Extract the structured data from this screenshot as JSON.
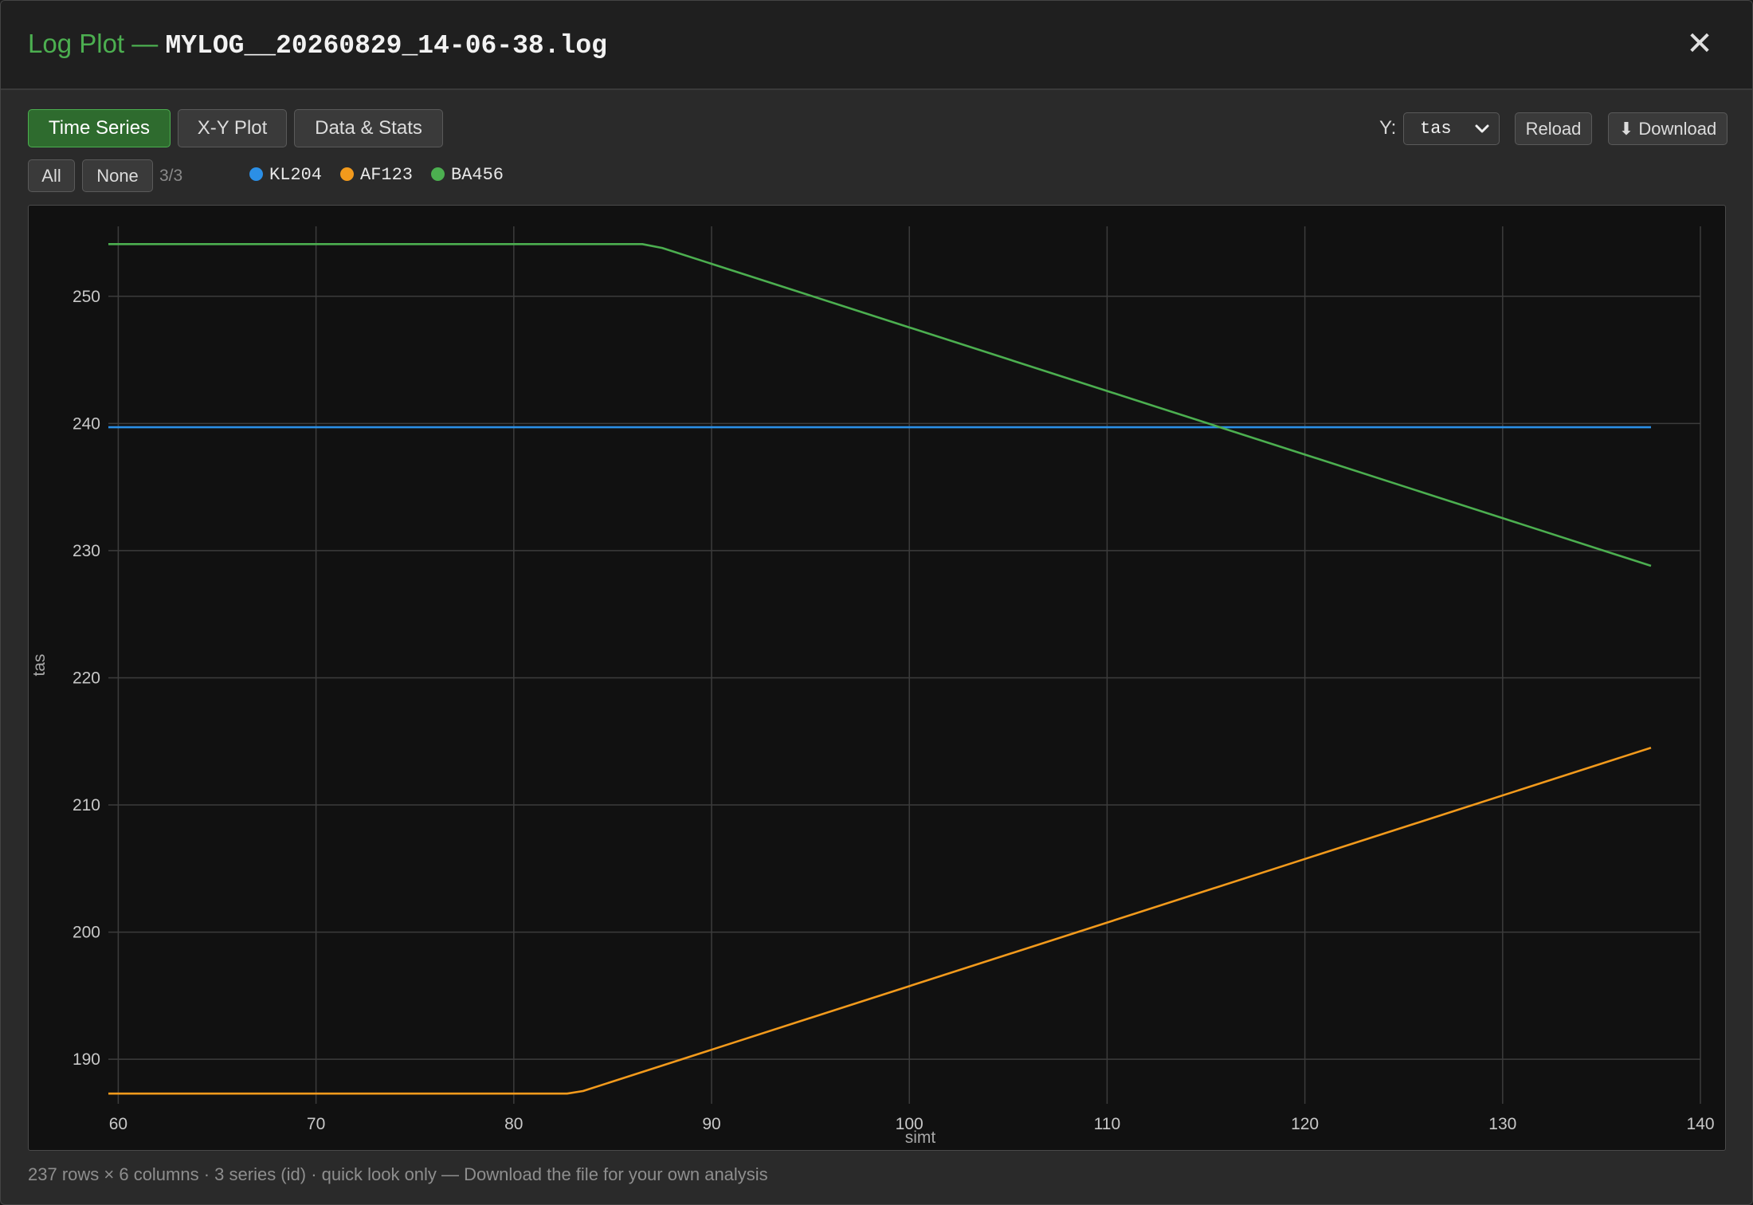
{
  "window": {
    "title_prefix": "Log Plot — ",
    "filename": "MYLOG__20260829_14-06-38.log",
    "close_glyph": "✕"
  },
  "tabs": [
    {
      "label": "Time Series",
      "active": true
    },
    {
      "label": "X-Y Plot",
      "active": false
    },
    {
      "label": "Data & Stats",
      "active": false
    }
  ],
  "series_filter": {
    "all_label": "All",
    "none_label": "None",
    "count": "3/3"
  },
  "legend": [
    {
      "name": "KL204",
      "color": "#2b8fe6"
    },
    {
      "name": "AF123",
      "color": "#f29a1c"
    },
    {
      "name": "BA456",
      "color": "#4caf50"
    }
  ],
  "toolbar": {
    "y_label": "Y:",
    "y_selected": "tas",
    "reload_label": "Reload",
    "download_label": "⬇ Download"
  },
  "footer": {
    "text": "237 rows × 6 columns · 3 series (id) · quick look only — Download the file for your own analysis"
  },
  "chart_data": {
    "type": "line",
    "xlabel": "simt",
    "ylabel": "tas",
    "xlim": [
      59.5,
      140
    ],
    "ylim": [
      186.5,
      255.5
    ],
    "xticks": [
      60,
      70,
      80,
      90,
      100,
      110,
      120,
      130,
      140
    ],
    "yticks": [
      190,
      200,
      210,
      220,
      230,
      240,
      250
    ],
    "grid": true,
    "series": [
      {
        "name": "KL204",
        "color": "#2b8fe6",
        "x": [
          59.5,
          137.5
        ],
        "y": [
          239.7,
          239.7
        ]
      },
      {
        "name": "AF123",
        "color": "#f29a1c",
        "x": [
          59.5,
          82.7,
          83.5,
          137.5
        ],
        "y": [
          187.3,
          187.3,
          187.5,
          214.5
        ]
      },
      {
        "name": "BA456",
        "color": "#4caf50",
        "x": [
          59.5,
          86.5,
          87.5,
          137.5
        ],
        "y": [
          254.1,
          254.1,
          253.8,
          228.8
        ]
      }
    ]
  }
}
